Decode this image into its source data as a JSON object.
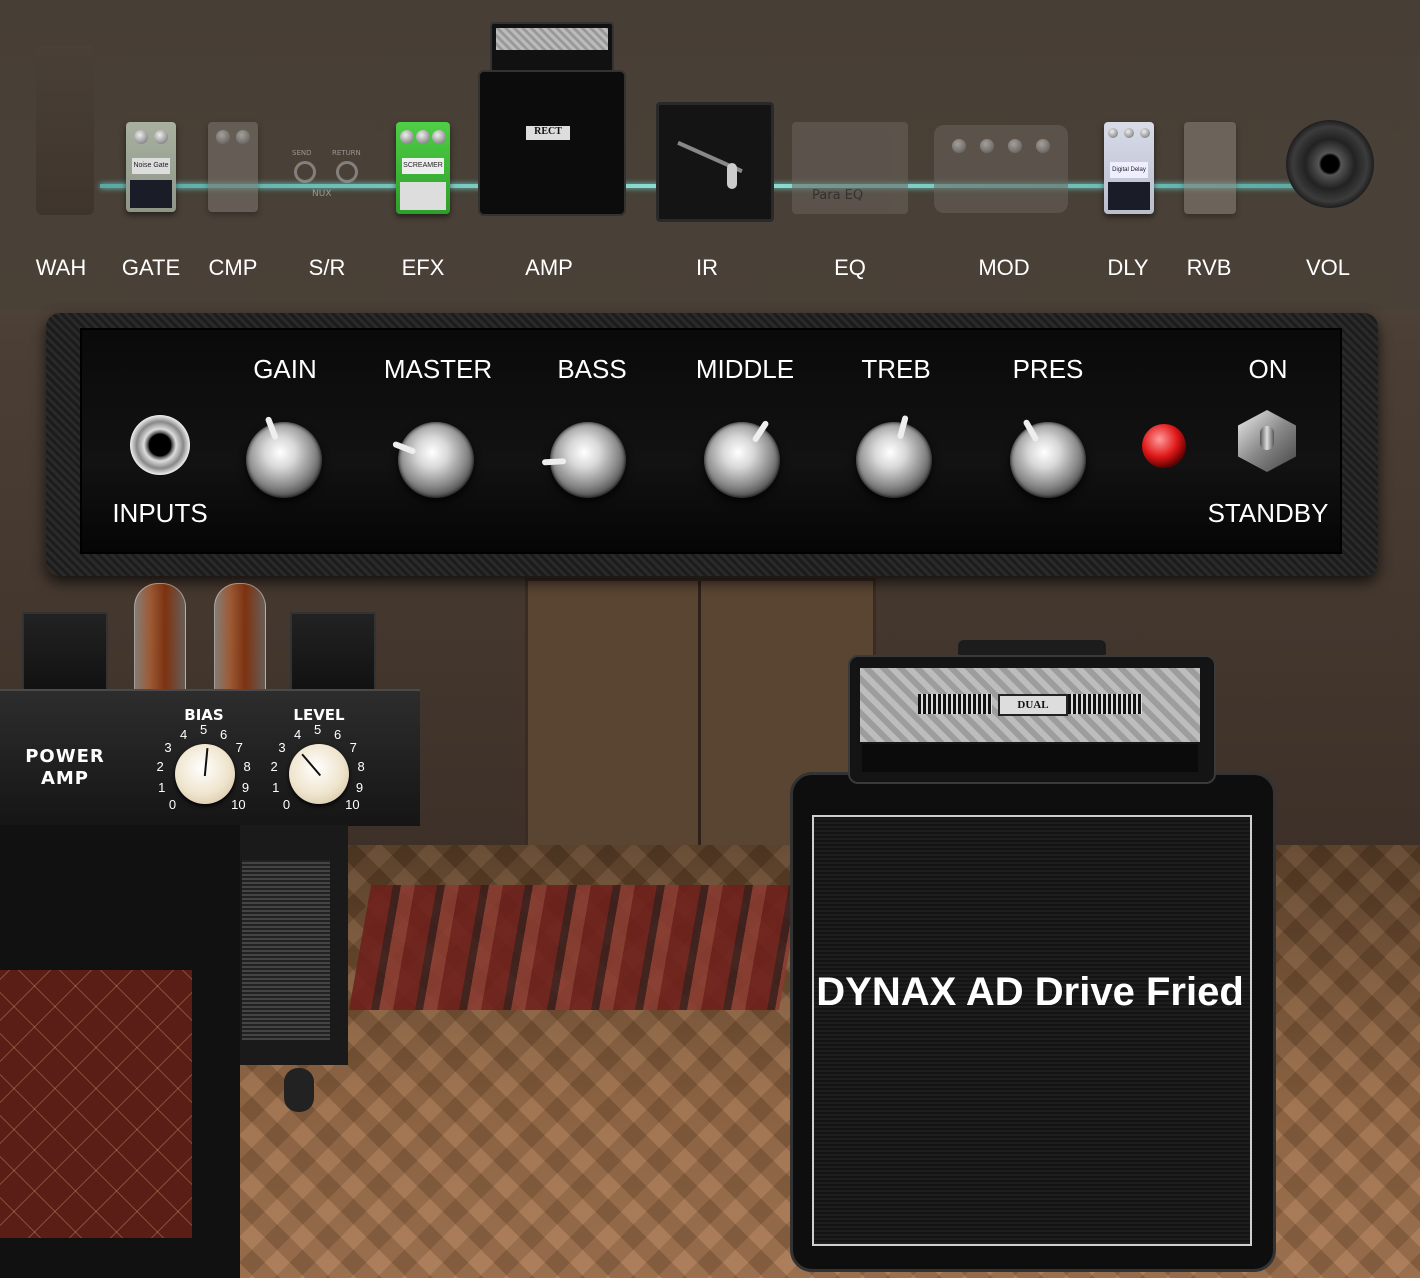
{
  "signal_chain": {
    "modules": [
      {
        "id": "wah",
        "label": "WAH",
        "active": false
      },
      {
        "id": "gate",
        "label": "GATE",
        "active": true
      },
      {
        "id": "cmp",
        "label": "CMP",
        "active": false
      },
      {
        "id": "sr",
        "label": "S/R",
        "active": false
      },
      {
        "id": "efx",
        "label": "EFX",
        "active": true
      },
      {
        "id": "amp",
        "label": "AMP",
        "active": true
      },
      {
        "id": "ir",
        "label": "IR",
        "active": true
      },
      {
        "id": "eq",
        "label": "EQ",
        "active": false
      },
      {
        "id": "mod",
        "label": "MOD",
        "active": false
      },
      {
        "id": "dly",
        "label": "DLY",
        "active": true
      },
      {
        "id": "rvb",
        "label": "RVB",
        "active": false
      },
      {
        "id": "vol",
        "label": "VOL",
        "active": true
      }
    ],
    "pedal_text": {
      "gate": "Noise Gate",
      "sr_send": "SEND",
      "sr_return": "RETURN",
      "sr_brand": "NUX",
      "efx": "SCREAMER",
      "amp": "RECT",
      "eq": "Para EQ",
      "dly": "Digital Delay"
    },
    "line_color": "#8fe0d8"
  },
  "amp_head": {
    "inputs_label": "INPUTS",
    "on_label": "ON",
    "standby_label": "STANDBY",
    "led_on": true,
    "knobs": [
      {
        "label": "GAIN",
        "value": 4.3
      },
      {
        "label": "MASTER",
        "value": 2.7
      },
      {
        "label": "BASS",
        "value": 1.9
      },
      {
        "label": "MIDDLE",
        "value": 6.1
      },
      {
        "label": "TREB",
        "value": 5.5
      },
      {
        "label": "PRES",
        "value": 4.0
      }
    ]
  },
  "power_amp": {
    "title_line1": "POWER",
    "title_line2": "AMP",
    "bias": {
      "label": "BIAS",
      "value": 5.2
    },
    "level": {
      "label": "LEVEL",
      "value": 3.5
    },
    "scale": [
      "0",
      "1",
      "2",
      "3",
      "4",
      "5",
      "6",
      "7",
      "8",
      "9",
      "10"
    ]
  },
  "cabinet": {
    "name": "DYNAX AD Drive Fried",
    "head_logo": "DUAL"
  }
}
